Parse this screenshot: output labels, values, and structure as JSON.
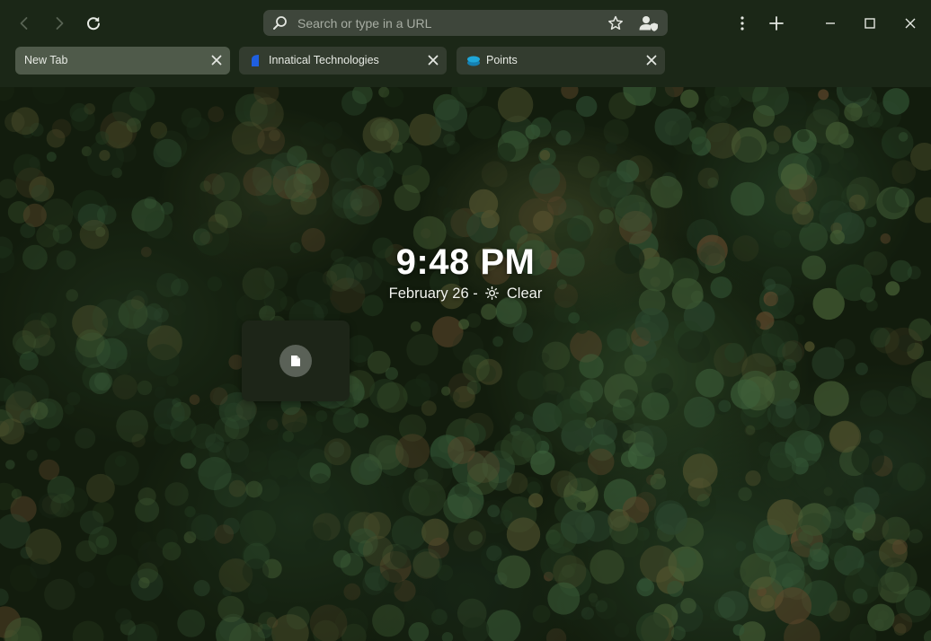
{
  "toolbar": {
    "address_placeholder": "Search or type in a URL",
    "address_value": ""
  },
  "tabs": [
    {
      "label": "New Tab",
      "active": true,
      "favicon": "none"
    },
    {
      "label": "Innatical Technologies",
      "active": false,
      "favicon": "innatical-logo-icon"
    },
    {
      "label": "Points",
      "active": false,
      "favicon": "points-logo-icon"
    }
  ],
  "newtab": {
    "time": "9:48 PM",
    "date": "February 26 -",
    "weather": "Clear",
    "weather_icon": "sun-icon",
    "shortcut_icon": "document-icon"
  },
  "colors": {
    "toolbar_bg": "#1b2717",
    "address_bg": "#3e463b",
    "tab_bg": "#333c2f",
    "tab_active_bg": "#4f5a4a",
    "innatical_blue": "#1f5fe0",
    "points_cyan": "#1fa6d8"
  }
}
